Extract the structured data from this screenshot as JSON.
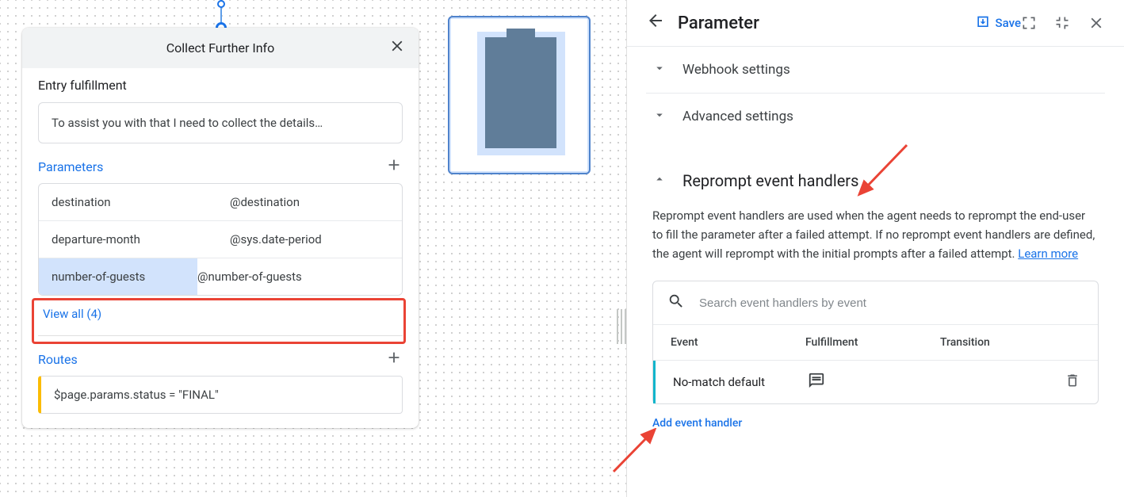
{
  "page_card": {
    "title": "Collect Further Info",
    "entry_label": "Entry fulfillment",
    "entry_text": "To assist you with that I need to collect the details…",
    "parameters_label": "Parameters",
    "params": [
      {
        "name": "destination",
        "type": "@destination"
      },
      {
        "name": "departure-month",
        "type": "@sys.date-period"
      },
      {
        "name": "number-of-guests",
        "type": "@number-of-guests"
      }
    ],
    "view_all": "View all (4)",
    "routes_label": "Routes",
    "route_cond": "$page.params.status = \"FINAL\""
  },
  "panel": {
    "title": "Parameter",
    "save": "Save",
    "webhook": "Webhook settings",
    "advanced": "Advanced settings",
    "reprompt_title": "Reprompt event handlers",
    "reprompt_desc": "Reprompt event handlers are used when the agent needs to reprompt the end-user to fill the parameter after a failed attempt. If no reprompt event handlers are defined, the agent will reprompt with the initial prompts after a failed attempt. ",
    "learn_more": "Learn more",
    "search_placeholder": "Search event handlers by event",
    "col_event": "Event",
    "col_fulfill": "Fulfillment",
    "col_trans": "Transition",
    "row_event": "No-match default",
    "add_handler": "Add event handler"
  }
}
